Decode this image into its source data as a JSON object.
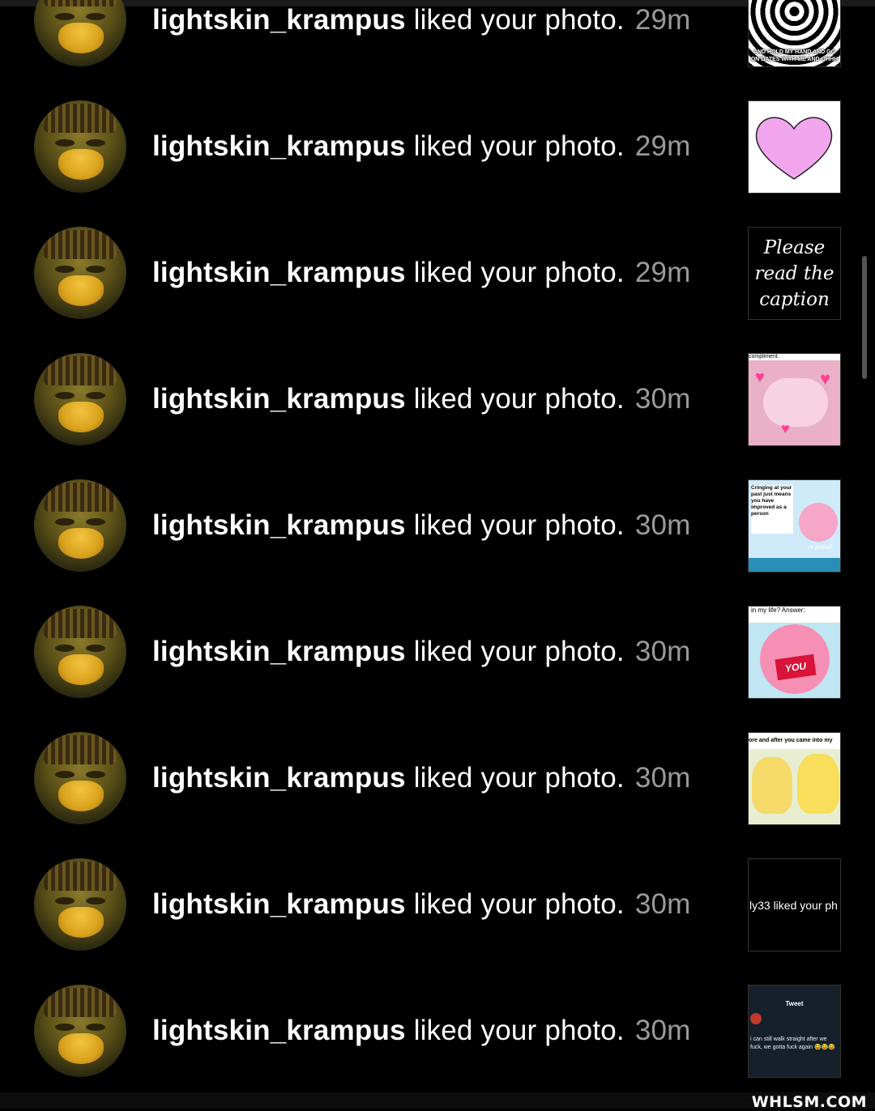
{
  "notifications": [
    {
      "username": "lightskin_krampus",
      "action": "liked your photo.",
      "time": "29m",
      "thumb": "spiral",
      "thumb_text": "AND HOLD MY HAND AND GO ON DATES WITH ME AND OHHH"
    },
    {
      "username": "lightskin_krampus",
      "action": "liked your photo.",
      "time": "29m",
      "thumb": "heart"
    },
    {
      "username": "lightskin_krampus",
      "action": "liked your photo.",
      "time": "29m",
      "thumb": "caption",
      "thumb_text": "Please read the caption"
    },
    {
      "username": "lightskin_krampus",
      "action": "liked your photo.",
      "time": "30m",
      "thumb": "axolotl",
      "thumb_text": "compliment."
    },
    {
      "username": "lightskin_krampus",
      "action": "liked your photo.",
      "time": "30m",
      "thumb": "kirby-proud",
      "thumb_text": "Cringing at your past just means you have improved as a person",
      "thumb_text2": "is proud"
    },
    {
      "username": "lightskin_krampus",
      "action": "liked your photo.",
      "time": "30m",
      "thumb": "kirby-you",
      "thumb_text": "in my life? Answer:",
      "thumb_text2": "YOU"
    },
    {
      "username": "lightskin_krampus",
      "action": "liked your photo.",
      "time": "30m",
      "thumb": "pikachu",
      "thumb_text": "ore and after you came into my"
    },
    {
      "username": "lightskin_krampus",
      "action": "liked your photo.",
      "time": "30m",
      "thumb": "dark-text",
      "thumb_text": "ly33 liked your ph"
    },
    {
      "username": "lightskin_krampus",
      "action": "liked your photo.",
      "time": "30m",
      "thumb": "tweet",
      "thumb_text": "Tweet",
      "thumb_text2": "i can still walk straight after we fuck, we gotta fuck again 😂😂😂"
    }
  ],
  "watermark": "WHLSM.COM"
}
